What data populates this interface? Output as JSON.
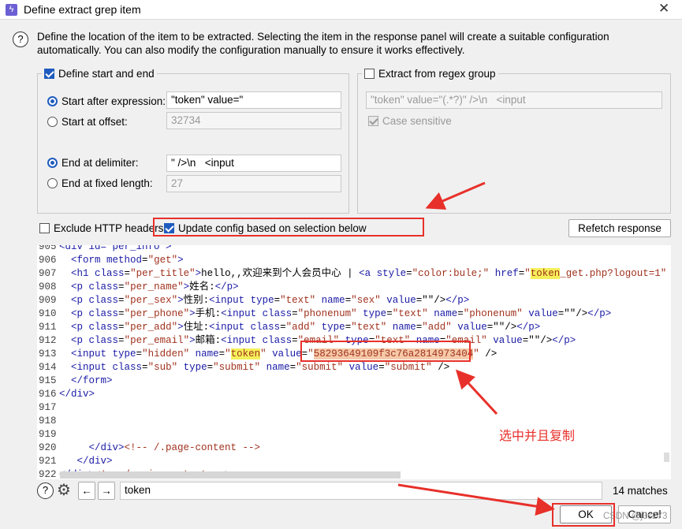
{
  "window": {
    "title": "Define extract grep item",
    "close": "✕"
  },
  "info": "Define the location of the item to be extracted. Selecting the item in the response panel will create a suitable configuration automatically. You can also modify the configuration manually to ensure it works effectively.",
  "start_end": {
    "label": "Define start and end",
    "checked": true,
    "start_after_label": "Start after expression:",
    "start_after_value": "\"token\" value=\"",
    "start_offset_label": "Start at offset:",
    "start_offset_value": "32734",
    "end_delim_label": "End at delimiter:",
    "end_delim_value": "\" />\\n   <input",
    "end_fixed_label": "End at fixed length:",
    "end_fixed_value": "27"
  },
  "regex": {
    "label": "Extract from regex group",
    "checked": false,
    "value": "\"token\" value=\"(.*?)\" />\\n   <input",
    "case_label": "Case sensitive"
  },
  "options": {
    "exclude_headers": "Exclude HTTP headers",
    "update_config": "Update config based on selection below",
    "refetch": "Refetch response"
  },
  "code_lines": [
    {
      "n": "905",
      "seg": [
        [
          "t",
          "<div id=\"per_info\">"
        ]
      ]
    },
    {
      "n": "906",
      "seg": [
        [
          "x",
          "  "
        ],
        [
          "t",
          "<form "
        ],
        [
          "a",
          "method"
        ],
        [
          "x",
          "="
        ],
        [
          "s",
          "\"get\""
        ],
        [
          "t",
          ">"
        ]
      ]
    },
    {
      "n": "907",
      "seg": [
        [
          "x",
          "  "
        ],
        [
          "t",
          "<h1 "
        ],
        [
          "a",
          "class"
        ],
        [
          "x",
          "="
        ],
        [
          "s",
          "\"per_title\""
        ],
        [
          "t",
          ">"
        ],
        [
          "x",
          "hello,,欢迎来到个人会员中心 | "
        ],
        [
          "t",
          "<a "
        ],
        [
          "a",
          "style"
        ],
        [
          "x",
          "="
        ],
        [
          "s",
          "\"color:bule;\" "
        ],
        [
          "a",
          "href"
        ],
        [
          "x",
          "="
        ],
        [
          "s",
          "\""
        ],
        [
          "h",
          "token"
        ],
        [
          "s",
          "_get.php?logout=1\""
        ]
      ]
    },
    {
      "n": "908",
      "seg": [
        [
          "x",
          "  "
        ],
        [
          "t",
          "<p "
        ],
        [
          "a",
          "class"
        ],
        [
          "x",
          "="
        ],
        [
          "s",
          "\"per_name\""
        ],
        [
          "t",
          ">"
        ],
        [
          "x",
          "姓名:"
        ],
        [
          "t",
          "</p>"
        ]
      ]
    },
    {
      "n": "909",
      "seg": [
        [
          "x",
          "  "
        ],
        [
          "t",
          "<p "
        ],
        [
          "a",
          "class"
        ],
        [
          "x",
          "="
        ],
        [
          "s",
          "\"per_sex\""
        ],
        [
          "t",
          ">"
        ],
        [
          "x",
          "性别:"
        ],
        [
          "t",
          "<input "
        ],
        [
          "a",
          "type"
        ],
        [
          "x",
          "="
        ],
        [
          "s",
          "\"text\" "
        ],
        [
          "a",
          "name"
        ],
        [
          "x",
          "="
        ],
        [
          "s",
          "\"sex\" "
        ],
        [
          "a",
          "value"
        ],
        [
          "x",
          "=\"\"/>"
        ],
        [
          "t",
          "</p>"
        ]
      ]
    },
    {
      "n": "910",
      "seg": [
        [
          "x",
          "  "
        ],
        [
          "t",
          "<p "
        ],
        [
          "a",
          "class"
        ],
        [
          "x",
          "="
        ],
        [
          "s",
          "\"per_phone\""
        ],
        [
          "t",
          ">"
        ],
        [
          "x",
          "手机:"
        ],
        [
          "t",
          "<input "
        ],
        [
          "a",
          "class"
        ],
        [
          "x",
          "="
        ],
        [
          "s",
          "\"phonenum\" "
        ],
        [
          "a",
          "type"
        ],
        [
          "x",
          "="
        ],
        [
          "s",
          "\"text\" "
        ],
        [
          "a",
          "name"
        ],
        [
          "x",
          "="
        ],
        [
          "s",
          "\"phonenum\" "
        ],
        [
          "a",
          "value"
        ],
        [
          "x",
          "=\"\"/>"
        ],
        [
          "t",
          "</p>"
        ]
      ]
    },
    {
      "n": "911",
      "seg": [
        [
          "x",
          "  "
        ],
        [
          "t",
          "<p "
        ],
        [
          "a",
          "class"
        ],
        [
          "x",
          "="
        ],
        [
          "s",
          "\"per_add\""
        ],
        [
          "t",
          ">"
        ],
        [
          "x",
          "住址:"
        ],
        [
          "t",
          "<input "
        ],
        [
          "a",
          "class"
        ],
        [
          "x",
          "="
        ],
        [
          "s",
          "\"add\" "
        ],
        [
          "a",
          "type"
        ],
        [
          "x",
          "="
        ],
        [
          "s",
          "\"text\" "
        ],
        [
          "a",
          "name"
        ],
        [
          "x",
          "="
        ],
        [
          "s",
          "\"add\" "
        ],
        [
          "a",
          "value"
        ],
        [
          "x",
          "=\"\"/>"
        ],
        [
          "t",
          "</p>"
        ]
      ]
    },
    {
      "n": "912",
      "seg": [
        [
          "x",
          "  "
        ],
        [
          "t",
          "<p "
        ],
        [
          "a",
          "class"
        ],
        [
          "x",
          "="
        ],
        [
          "s",
          "\"per_email\""
        ],
        [
          "t",
          ">"
        ],
        [
          "x",
          "邮箱:"
        ],
        [
          "t",
          "<input "
        ],
        [
          "a",
          "class"
        ],
        [
          "x",
          "="
        ],
        [
          "s",
          "\"email\" "
        ],
        [
          "a",
          "type"
        ],
        [
          "x",
          "="
        ],
        [
          "s",
          "\"text\" "
        ],
        [
          "a",
          "name"
        ],
        [
          "x",
          "="
        ],
        [
          "s",
          "\"email\" "
        ],
        [
          "a",
          "value"
        ],
        [
          "x",
          "=\"\"/>"
        ],
        [
          "t",
          "</p>"
        ]
      ]
    },
    {
      "n": "913",
      "seg": [
        [
          "x",
          "  "
        ],
        [
          "t",
          "<input "
        ],
        [
          "a",
          "type"
        ],
        [
          "x",
          "="
        ],
        [
          "s",
          "\"hidden\" "
        ],
        [
          "a",
          "name"
        ],
        [
          "x",
          "="
        ],
        [
          "s",
          "\""
        ],
        [
          "h",
          "token"
        ],
        [
          "s",
          "\" "
        ],
        [
          "a",
          "value"
        ],
        [
          "x",
          "="
        ],
        [
          "s",
          "\""
        ],
        [
          "sel",
          "58293649109f3c76a2814973404"
        ],
        [
          "s",
          "\""
        ],
        [
          "x",
          " />"
        ]
      ]
    },
    {
      "n": "914",
      "seg": [
        [
          "x",
          "  "
        ],
        [
          "t",
          "<input "
        ],
        [
          "a",
          "class"
        ],
        [
          "x",
          "="
        ],
        [
          "s",
          "\"sub\" "
        ],
        [
          "a",
          "type"
        ],
        [
          "x",
          "="
        ],
        [
          "s",
          "\"submit\" "
        ],
        [
          "a",
          "name"
        ],
        [
          "x",
          "="
        ],
        [
          "s",
          "\"submit\" "
        ],
        [
          "a",
          "value"
        ],
        [
          "x",
          "="
        ],
        [
          "s",
          "\"submit\""
        ],
        [
          "x",
          " />"
        ]
      ]
    },
    {
      "n": "915",
      "seg": [
        [
          "x",
          "  "
        ],
        [
          "t",
          "</form>"
        ]
      ]
    },
    {
      "n": "916",
      "seg": [
        [
          "t",
          "</div>"
        ]
      ]
    },
    {
      "n": "917",
      "seg": []
    },
    {
      "n": "918",
      "seg": []
    },
    {
      "n": "919",
      "seg": []
    },
    {
      "n": "920",
      "seg": [
        [
          "x",
          "     "
        ],
        [
          "t",
          "</div>"
        ],
        [
          "s",
          "<!-- /.page-content -->"
        ]
      ]
    },
    {
      "n": "921",
      "seg": [
        [
          "x",
          "   "
        ],
        [
          "t",
          "</div>"
        ]
      ]
    },
    {
      "n": "922",
      "seg": [
        [
          "t",
          "</div>"
        ],
        [
          "s",
          "<!-- /.main-content -->"
        ]
      ]
    }
  ],
  "search": {
    "value": "token",
    "matches": "14 matches",
    "help": "?",
    "prev": "←",
    "next": "→"
  },
  "buttons": {
    "ok": "OK",
    "cancel": "Cancel"
  },
  "annotation": {
    "note": "选中并且复制",
    "color": "#e8302a"
  },
  "watermark": "CSDN @j3s273"
}
